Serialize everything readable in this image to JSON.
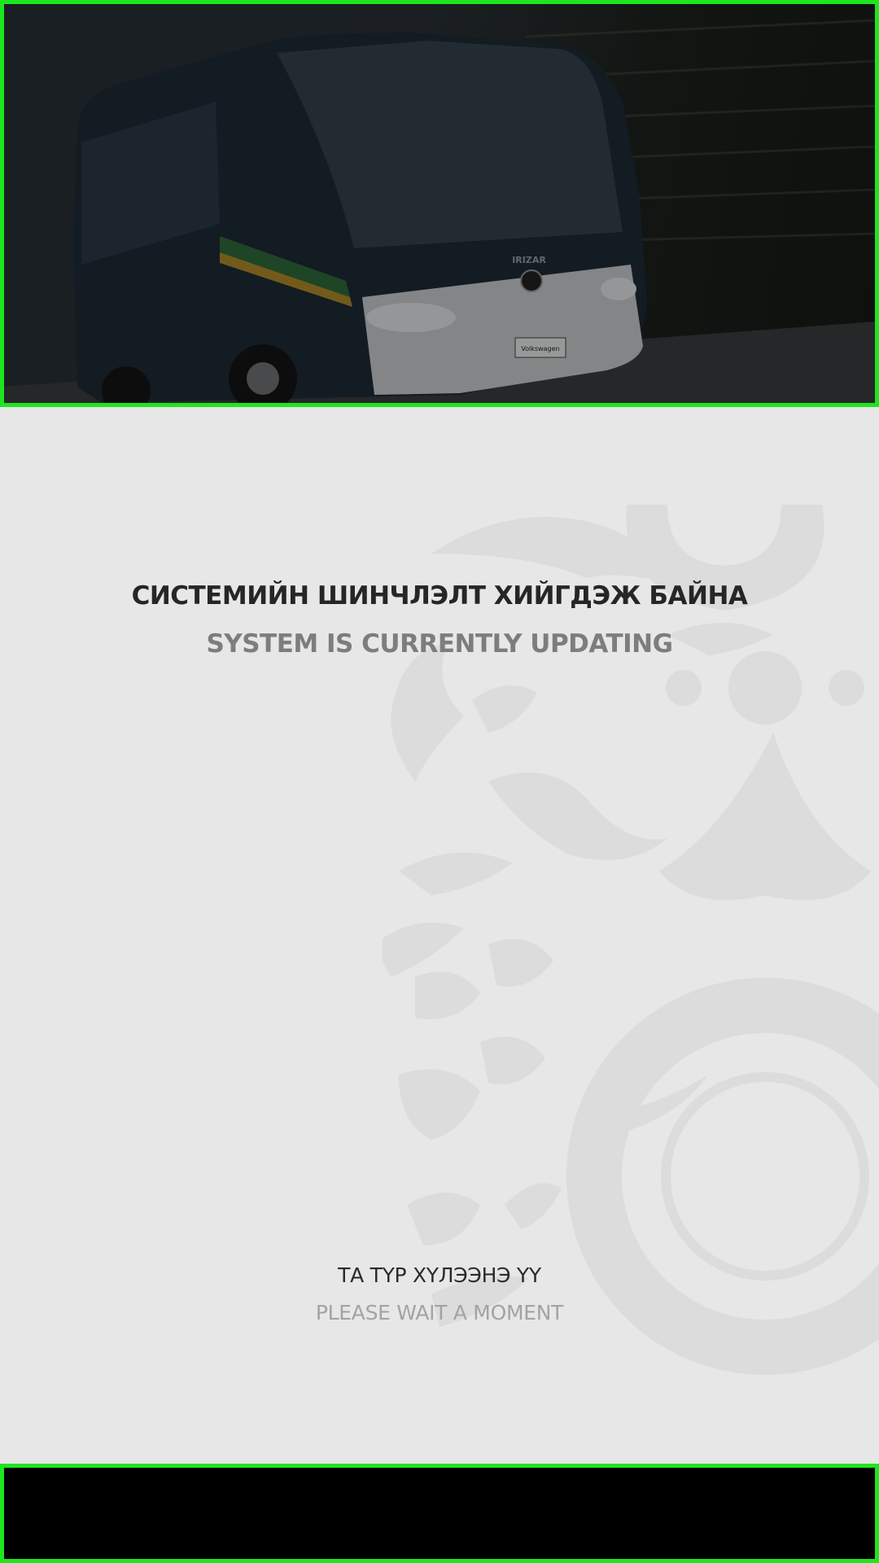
{
  "hero": {
    "image_subject": "coach-bus",
    "bus_brand_text": "IRIZAR",
    "plate_text": "Volkswagen"
  },
  "messages": {
    "title_mn": "СИСТЕМИЙН ШИНЧЛЭЛТ ХИЙГДЭЖ БАЙНА",
    "title_en": "SYSTEM IS  CURRENTLY UPDATING",
    "wait_mn": "ТА ТҮР ХҮЛЭЭНЭ ҮҮ",
    "wait_en": "PLEASE WAIT A MOMENT"
  },
  "colors": {
    "background": "#e7e7e7",
    "frame_border": "#1ee61e",
    "footer": "#000000",
    "title_primary": "#262626",
    "title_secondary": "#7d7d7d",
    "wait_secondary": "#a3a3a3"
  }
}
